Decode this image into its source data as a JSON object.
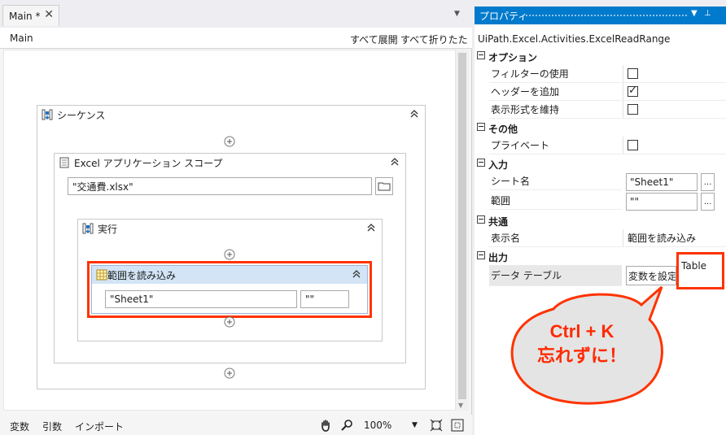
{
  "designer": {
    "tab_label": "Main *",
    "tab_close": "✕",
    "breadcrumb": "Main",
    "expand_all": "すべて展開",
    "collapse_all": "すべて折りたたみ",
    "sequence_label": "シーケンス",
    "excel_scope_label": "Excel アプリケーション スコープ",
    "excel_file_value": "\"交通費.xlsx\"",
    "execute_label": "実行",
    "read_range_label": "範囲を読み込み",
    "sheet_value": "\"Sheet1\"",
    "range_value": "\"\""
  },
  "statusbar": {
    "variables": "変数",
    "arguments": "引数",
    "imports": "インポート",
    "zoom": "100%"
  },
  "properties": {
    "title": "プロパティ",
    "activity_type": "UiPath.Excel.Activities.ExcelReadRange",
    "categories": [
      {
        "name": "オプション"
      },
      {
        "name": "その他"
      },
      {
        "name": "入力"
      },
      {
        "name": "共通"
      },
      {
        "name": "出力"
      }
    ],
    "options": {
      "use_filter": "フィルターの使用",
      "add_headers": "ヘッダーを追加",
      "preserve_format": "表示形式を維持",
      "add_headers_checked": true
    },
    "misc": {
      "private": "プライベート"
    },
    "input": {
      "sheet_name": "シート名",
      "sheet_name_value": "\"Sheet1\"",
      "range": "範囲",
      "range_value": "\"\"",
      "ellipsis": "..."
    },
    "common": {
      "display_name": "表示名",
      "display_name_value": "範囲を読み込み"
    },
    "output": {
      "data_table": "データ テーブル",
      "set_variable": "変数を設定:",
      "variable_value": "Table"
    }
  },
  "callout": {
    "line1": "Ctrl + K",
    "line2": "忘れずに！"
  },
  "colors": {
    "accent": "#007acc",
    "highlight": "#ff3300"
  }
}
